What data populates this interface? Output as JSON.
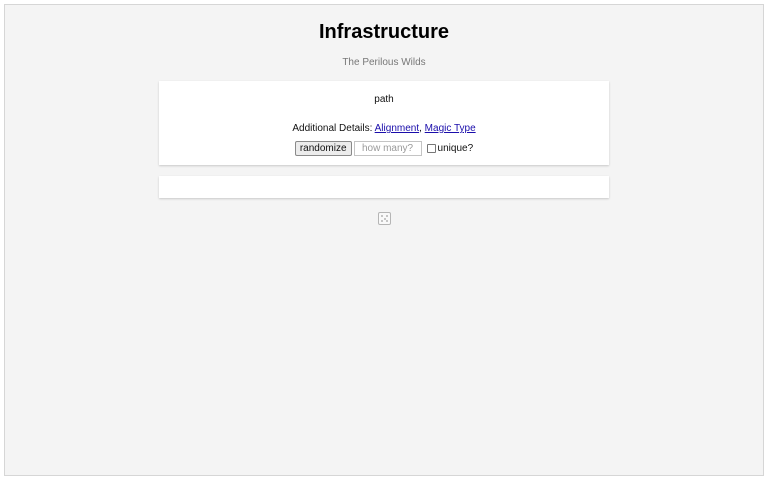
{
  "header": {
    "title": "Infrastructure",
    "subtitle": "The Perilous Wilds"
  },
  "generator": {
    "result": "path",
    "details_label": "Additional Details:",
    "details_links": [
      "Alignment",
      "Magic Type"
    ],
    "details_separator": ",",
    "randomize_label": "randomize",
    "count_placeholder": "how many?",
    "unique_label": "unique?",
    "unique_checked": false
  },
  "output": {
    "text": ""
  },
  "icons": {
    "dice": "dice-icon"
  }
}
